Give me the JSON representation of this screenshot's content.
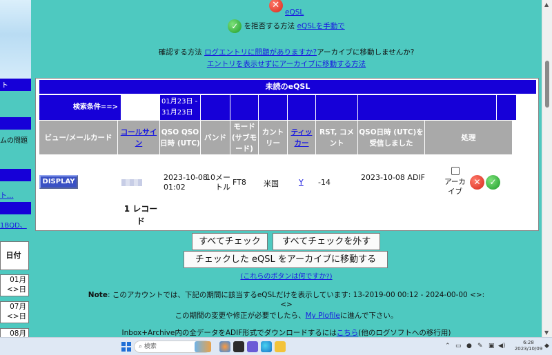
{
  "top": {
    "eqsl_link": "eQSL",
    "reject_text": "を拒否する方法",
    "reject_link": "eQSLを手動で",
    "confirm_text": "確認する方法",
    "confirm_link": "ログエントリに問題がありますか?",
    "confirm_tail": "アーカイブに移動しませんか?",
    "archive_link": "エントリを表示せずにアーカイブに移動する方法"
  },
  "sidebar": {
    "item1": "ト",
    "item2": "ムの問題",
    "item3": "ト...",
    "item4": "1BQD、",
    "date_header": "日付",
    "date1_a": "01月",
    "date1_b": "<>日",
    "date2_a": "07月",
    "date2_b": "<>日",
    "date3_a": "08月"
  },
  "panel": {
    "title": "未読のeQSL",
    "search_label": "検索条件==>",
    "date_range": "01月23日 - 31月23日",
    "headers": {
      "view": "ビュー/メールカード",
      "callsign": "コールサイン",
      "qso_time": "QSO QSO日時 (UTC)",
      "band": "バンド",
      "mode": "モード(サブモード)",
      "country": "カントリー",
      "ticker": "ティッカー",
      "rst": "RST, コメント",
      "received": "QSO日時 (UTC)を受信しました",
      "action": "処理"
    },
    "row": {
      "display_button": "DISPLAY",
      "qso_time": "2023-10-08 01:02",
      "band": "10メートル",
      "mode": "FT8",
      "country": "米国",
      "ticker": "Y",
      "rst": "-14",
      "received": "2023-10-08 ADIF",
      "archive_label": "アーカイブ"
    },
    "record_count": "1 レコード"
  },
  "buttons": {
    "check_all": "すべてチェック",
    "uncheck_all": "すべてチェックを外す",
    "move_checked": "チェックした eQSL をアーカイブに移動する",
    "what_link": "(これらのボタンは何ですか?)"
  },
  "note": {
    "label": "Note",
    "text": ": このアカウントでは、下記の期間に該当するeQSLだけを表示しています: 13-2019-00 00:12 - 2024-00-00 <>:",
    "line2": "<>",
    "change_text": "この期間の変更や修正が必要でしたら、",
    "profile_link": "My Plofile",
    "change_tail": "に進んで下さい。"
  },
  "inbox": {
    "text": "Inbox+Archive内の全データをADIF形式でダウンロードするには",
    "link": "こちら",
    "tail": "(他のログソフトへの移行用)"
  },
  "taskbar": {
    "search_placeholder": "検索",
    "time": "6:28",
    "date": "2023/10/09"
  }
}
